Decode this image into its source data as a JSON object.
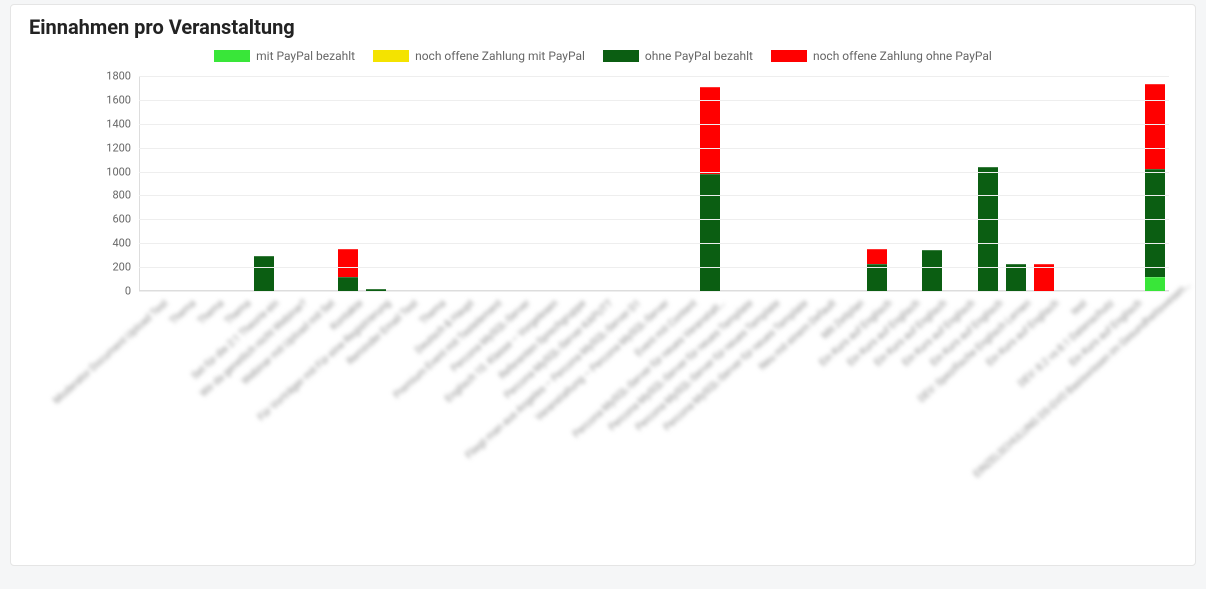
{
  "title": "Einnahmen pro Veranstaltung",
  "legend": {
    "s1": "mit PayPal bezahlt",
    "s2": "noch offene Zahlung mit PayPal",
    "s3": "ohne PayPal bezahlt",
    "s4": "noch offene Zahlung ohne PayPal"
  },
  "colors": {
    "s1": "#39e639",
    "s2": "#f4e300",
    "s3": "#0b5e12",
    "s4": "#ff0000"
  },
  "chart_data": {
    "type": "bar",
    "stacked": true,
    "ylim": [
      0,
      1800
    ],
    "yticks": [
      0,
      200,
      400,
      600,
      800,
      1000,
      1200,
      1400,
      1600,
      1800
    ],
    "ylabel": "",
    "xlabel": "",
    "title": "Einnahmen pro Veranstaltung",
    "categories": [
      "Moderator Document Upload Test",
      "Thema",
      "Thema",
      "Thema",
      "Set für die 2:1 Theorie ein",
      "Wir da genetlich nicht Webinar?",
      "Webinar mit Upload mit Set",
      "Kontakte",
      "Für Vorträger mit Für eine Registrierung",
      "Reminder Email Test",
      "Thema",
      "Deutsch & Haupt",
      "Premium Event mit Testelement",
      "Percona MySQL-Server",
      "Englisch 10. Klasse – Vorgelesen",
      "Referenten Sprechgruppe",
      "Percona MySQL-Server KAPUTT",
      "Fliegt man aus Angeles – Percona MySQL-Server D1",
      "Veranstaltung – Percona MySQL-Server",
      "Event mit Content",
      "Percona MySQL-Server für neues Veranstalt…",
      "Percona MySQL-Server für neues Template",
      "Percona MySQL-Server für neues Template",
      "Percona MySQL-Server für neues Template",
      "Neu mit einem Default",
      "Mit Zeitplan",
      "Ein Kurs auf Englisch",
      "Ein Kurs auf Englisch",
      "Ein Kurs auf Englisch",
      "Ein Kurs auf Englisch",
      "Ein Kurs auf Englisch",
      "DEV: Spezifische Englisch Lernen",
      "Ein Kurs auf Englisch",
      "test",
      "DEV: 8.2 vs 8.1 Datenschutz",
      "Ein Kurs auf Englisch",
      "EINZELSCHULUNG DS-GVO Basiswissen im Gesundheitswesen…"
    ],
    "series": [
      {
        "name": "mit PayPal bezahlt",
        "key": "s1",
        "values": [
          0,
          0,
          0,
          0,
          0,
          0,
          0,
          0,
          0,
          0,
          0,
          0,
          0,
          0,
          0,
          0,
          0,
          0,
          0,
          0,
          0,
          0,
          0,
          0,
          0,
          0,
          0,
          0,
          0,
          0,
          0,
          0,
          0,
          0,
          0,
          0,
          120
        ]
      },
      {
        "name": "noch offene Zahlung mit PayPal",
        "key": "s2",
        "values": [
          0,
          0,
          0,
          0,
          0,
          0,
          0,
          0,
          0,
          0,
          0,
          0,
          0,
          0,
          0,
          0,
          0,
          0,
          0,
          0,
          0,
          0,
          0,
          0,
          0,
          0,
          0,
          0,
          0,
          0,
          0,
          0,
          0,
          0,
          0,
          0,
          0
        ]
      },
      {
        "name": "ohne PayPal bezahlt",
        "key": "s3",
        "values": [
          0,
          0,
          0,
          0,
          290,
          0,
          0,
          120,
          20,
          0,
          0,
          0,
          0,
          0,
          0,
          0,
          0,
          0,
          0,
          0,
          980,
          0,
          0,
          0,
          0,
          0,
          230,
          0,
          340,
          0,
          1040,
          230,
          0,
          0,
          0,
          0,
          900
        ]
      },
      {
        "name": "noch offene Zahlung ohne PayPal",
        "key": "s4",
        "values": [
          0,
          0,
          0,
          0,
          0,
          0,
          0,
          230,
          0,
          0,
          0,
          0,
          0,
          0,
          0,
          0,
          0,
          0,
          0,
          0,
          730,
          0,
          0,
          0,
          0,
          0,
          120,
          0,
          0,
          0,
          0,
          0,
          230,
          0,
          0,
          0,
          710
        ]
      }
    ]
  }
}
